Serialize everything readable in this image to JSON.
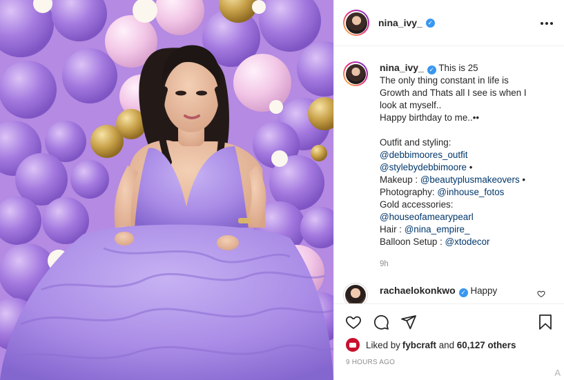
{
  "post": {
    "username": "nina_ivy_",
    "verified_mark": "✓",
    "more_icon": "more-horizontal-icon"
  },
  "caption": {
    "username": "nina_ivy_",
    "lines": {
      "l1": "This is 25",
      "l2": "The only thing constant in life is",
      "l3": "Growth and Thats all I see is when I",
      "l4": "look at myself..",
      "l5": "Happy birthday to me..••",
      "l6": "Outfit and styling:",
      "l7_mention": "@debbimoores_outfit",
      "l8_mention": "@stylebydebbimoore",
      "l8_tail": " •",
      "l9_pre": "Makeup : ",
      "l9_mention": "@beautyplusmakeovers",
      "l9_tail": " •",
      "l10_pre": "Photography: ",
      "l10_mention": "@inhouse_fotos",
      "l11": "Gold accessories:",
      "l12_mention": "@houseofamearypearl",
      "l13_pre": "Hair : ",
      "l13_mention": "@nina_empire_",
      "l14_pre": "Balloon Setup : ",
      "l14_mention": "@xtodecor"
    },
    "time": "9h"
  },
  "comment": {
    "username": "rachaelokonkwo",
    "text": "Happy"
  },
  "actions": {
    "icons": [
      "heart-icon",
      "comment-icon",
      "share-icon",
      "bookmark-icon"
    ]
  },
  "likes": {
    "prefix": "Liked by ",
    "user": "fybcraft",
    "middle": " and ",
    "count": "60,127 others"
  },
  "posted_ago": "9 HOURS AGO",
  "corner_mark": "A",
  "colors": {
    "accent_blue": "#3897f0",
    "mention": "#00376b",
    "muted": "#8e8e8e",
    "balloon_purple": "#a57be0",
    "balloon_pink": "#f2c6e6",
    "balloon_gold": "#c9a24a",
    "dress_lavender": "#a98be6"
  }
}
